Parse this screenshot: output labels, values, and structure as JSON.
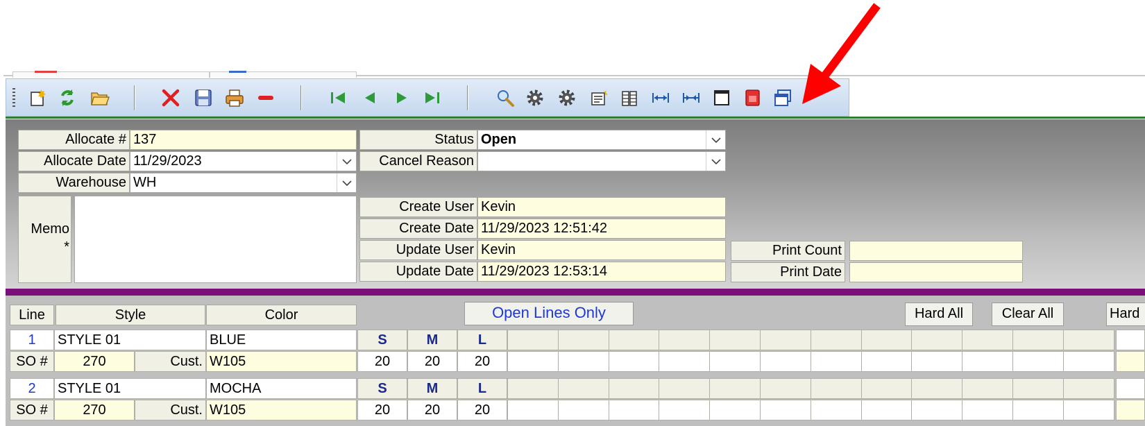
{
  "toolbar": {
    "icons": [
      "new-icon",
      "refresh-icon",
      "open-folder-icon",
      "delete-icon",
      "save-icon",
      "print-icon",
      "remove-icon",
      "first-record-icon",
      "previous-record-icon",
      "next-record-icon",
      "last-record-icon",
      "search-icon",
      "settings-icon",
      "settings-alt-icon",
      "export-icon",
      "columns-icon",
      "expand-columns-icon",
      "shrink-columns-icon",
      "window-icon",
      "pdf-icon",
      "restore-window-icon"
    ]
  },
  "header": {
    "allocate_no_label": "Allocate #",
    "allocate_no": "137",
    "allocate_date_label": "Allocate Date",
    "allocate_date": "11/29/2023",
    "warehouse_label": "Warehouse",
    "warehouse": "WH",
    "memo_label": "Memo",
    "memo_star": "*",
    "memo": "",
    "status_label": "Status",
    "status": "Open",
    "cancel_reason_label": "Cancel Reason",
    "cancel_reason": "",
    "create_user_label": "Create User",
    "create_user": "Kevin",
    "create_date_label": "Create Date",
    "create_date": "11/29/2023 12:51:42",
    "update_user_label": "Update User",
    "update_user": "Kevin",
    "update_date_label": "Update Date",
    "update_date": "11/29/2023 12:53:14",
    "print_count_label": "Print Count",
    "print_count": "",
    "print_date_label": "Print Date",
    "print_date": ""
  },
  "grid": {
    "col_line": "Line",
    "col_style": "Style",
    "col_color": "Color",
    "open_lines_button": "Open Lines Only",
    "hard_all_button": "Hard All",
    "clear_all_button": "Clear All",
    "hard_col": "Hard",
    "so_label": "SO #",
    "cust_label": "Cust.",
    "rows": [
      {
        "line": "1",
        "style": "STYLE 01",
        "color": "BLUE",
        "so": "270",
        "cust": "W105",
        "sizes": [
          "S",
          "M",
          "L"
        ],
        "qtys": [
          "20",
          "20",
          "20"
        ]
      },
      {
        "line": "2",
        "style": "STYLE 01",
        "color": "MOCHA",
        "so": "270",
        "cust": "W105",
        "sizes": [
          "S",
          "M",
          "L"
        ],
        "qtys": [
          "20",
          "20",
          "20"
        ]
      }
    ]
  },
  "annotation": {
    "arrow_color": "#ff0000"
  }
}
